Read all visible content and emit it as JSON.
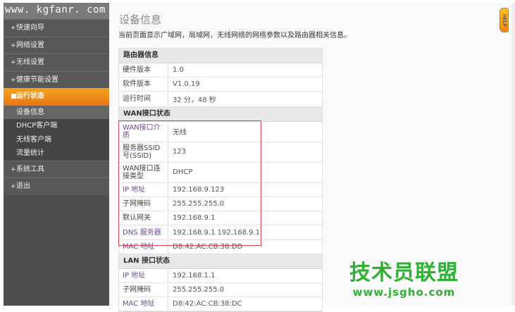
{
  "logo_text": "www. kgfanr. com",
  "menu": [
    {
      "label": "快速向导",
      "bullet": "+"
    },
    {
      "label": "网络设置",
      "bullet": "+"
    },
    {
      "label": "无线设置",
      "bullet": "+"
    },
    {
      "label": "健康节能设置",
      "bullet": "+"
    },
    {
      "label": "运行状态",
      "bullet": "■"
    },
    {
      "label": "系统工具",
      "bullet": "+"
    },
    {
      "label": "退出",
      "bullet": "+"
    }
  ],
  "submenu": [
    "设备信息",
    "DHCP客户端",
    "无线客户端",
    "流量统计"
  ],
  "page": {
    "title": "设备信息",
    "description": "当前页面显示广域网，局域网，无线网络的网络参数以及路由器相关信息。"
  },
  "help_label": "HELP",
  "router": {
    "header": "路由器信息",
    "rows": [
      {
        "label": "硬件版本",
        "value": "1.0"
      },
      {
        "label": "软件版本",
        "value": "V1.0.19"
      },
      {
        "label": "运行时间",
        "value": "32 分，48 秒"
      }
    ]
  },
  "wan": {
    "header": "WAN接口状态",
    "rows": [
      {
        "label": "WAN接口介质",
        "value": "无线"
      },
      {
        "label": "服务器SSID号(SSID)",
        "value": "123"
      },
      {
        "label": "WAN接口连接类型",
        "value": "DHCP"
      },
      {
        "label": "IP 地址",
        "value": "192.168.9.123"
      },
      {
        "label": "子网掩码",
        "value": "255.255.255.0"
      },
      {
        "label": "默认网关",
        "value": "192.168.9.1"
      },
      {
        "label": "DNS 服务器",
        "value": "192.168.9.1 192.168.9.1"
      },
      {
        "label": "MAC 地址",
        "value": "D8:42:AC:CB:38:DD"
      }
    ]
  },
  "lan": {
    "header": "LAN 接口状态",
    "rows": [
      {
        "label": "IP 地址",
        "value": "192.168.1.1"
      },
      {
        "label": "子网掩码",
        "value": "255.255.255.0"
      },
      {
        "label": "MAC 地址",
        "value": "D8:42:AC:CB:38:DC"
      }
    ]
  },
  "watermark": {
    "name": "技术员联盟",
    "url": "www.jsgho.com"
  },
  "colors": {
    "accent": "#f39019",
    "highlight": "#e0434a"
  }
}
